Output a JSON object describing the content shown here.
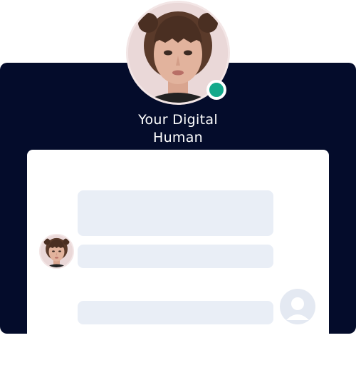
{
  "profile": {
    "name": "Your Digital Human",
    "name_line1": "Your Digital",
    "name_line2": "Human",
    "status": "online"
  },
  "colors": {
    "panel": "#040c2b",
    "status": "#13a98b",
    "bubble": "#e9eef6",
    "user_avatar": "#e4e9f2"
  },
  "chat": {
    "messages": [
      {
        "from": "digital-human",
        "content": ""
      },
      {
        "from": "digital-human",
        "content": ""
      },
      {
        "from": "user",
        "content": ""
      }
    ]
  },
  "icons": {
    "avatar": "digital-human-portrait",
    "user": "user-silhouette-icon",
    "status": "online-status-dot"
  }
}
